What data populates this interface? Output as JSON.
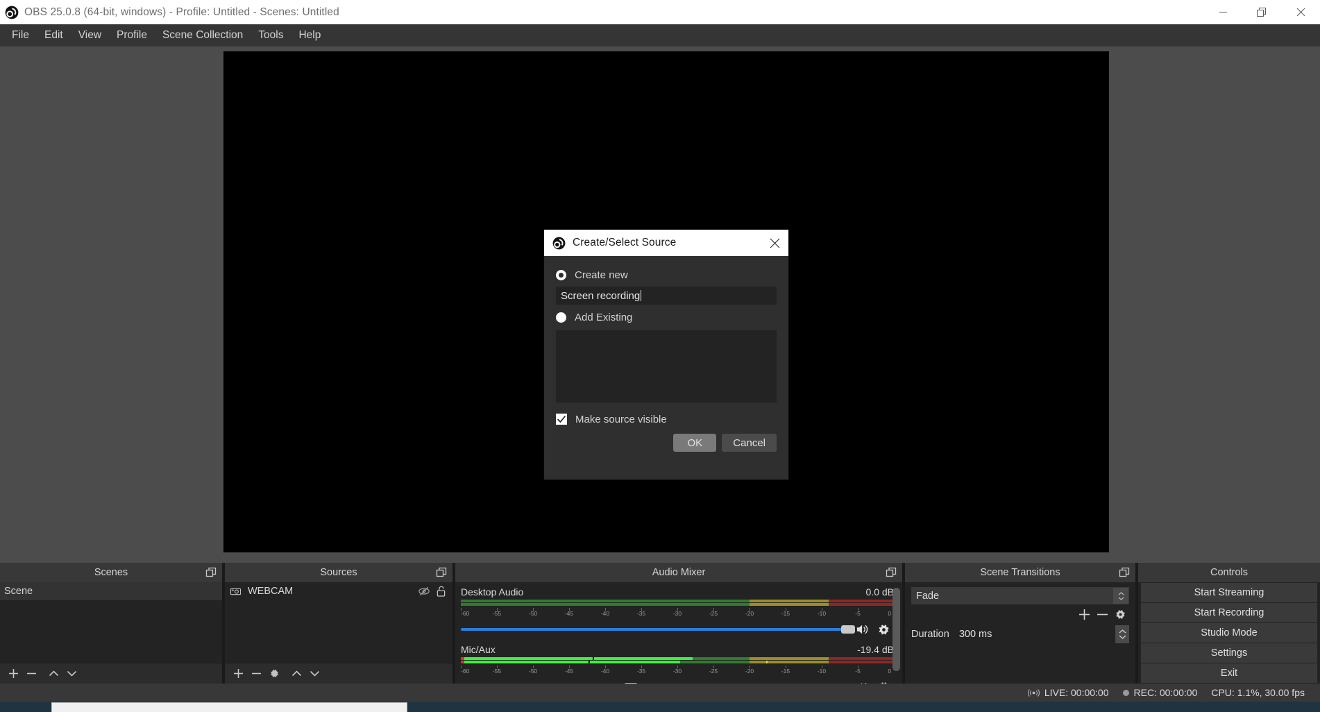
{
  "window": {
    "title": "OBS 25.0.8 (64-bit, windows) - Profile: Untitled - Scenes: Untitled",
    "logo_icon": "obs-logo-icon",
    "minimize_icon": "minimize-icon",
    "restore_icon": "restore-icon",
    "close_icon": "close-icon"
  },
  "menubar": {
    "items": [
      {
        "label": "File"
      },
      {
        "label": "Edit"
      },
      {
        "label": "View"
      },
      {
        "label": "Profile"
      },
      {
        "label": "Scene Collection"
      },
      {
        "label": "Tools"
      },
      {
        "label": "Help"
      }
    ]
  },
  "dialog": {
    "title": "Create/Select Source",
    "logo_icon": "obs-logo-icon",
    "close_icon": "close-icon",
    "create_new": {
      "label": "Create new",
      "selected": true
    },
    "source_name": {
      "value": "Screen recording",
      "placeholder": ""
    },
    "add_existing": {
      "label": "Add Existing",
      "selected": false
    },
    "existing_sources": [],
    "make_source_visible": {
      "label": "Make source visible",
      "checked": true
    },
    "ok_label": "OK",
    "cancel_label": "Cancel"
  },
  "docks": {
    "scenes": {
      "title": "Scenes",
      "popout_icon": "popout-icon",
      "items": [
        {
          "label": "Scene",
          "selected": true
        }
      ],
      "toolbar": [
        {
          "name": "add-scene-button",
          "icon": "plus-icon"
        },
        {
          "name": "remove-scene-button",
          "icon": "minus-icon"
        },
        {
          "name": "move-scene-up-button",
          "icon": "chevron-up-icon"
        },
        {
          "name": "move-scene-down-button",
          "icon": "chevron-down-icon"
        }
      ]
    },
    "sources": {
      "title": "Sources",
      "popout_icon": "popout-icon",
      "items": [
        {
          "label": "WEBCAM",
          "type_icon": "camera-icon",
          "visibility_icon": "eye-slash-icon",
          "lock_icon": "unlock-icon"
        }
      ],
      "toolbar": [
        {
          "name": "add-source-button",
          "icon": "plus-icon"
        },
        {
          "name": "remove-source-button",
          "icon": "minus-icon"
        },
        {
          "name": "source-properties-button",
          "icon": "gear-icon"
        },
        {
          "name": "move-source-up-button",
          "icon": "chevron-up-icon"
        },
        {
          "name": "move-source-down-button",
          "icon": "chevron-down-icon"
        }
      ]
    },
    "audio_mixer": {
      "title": "Audio Mixer",
      "popout_icon": "popout-icon",
      "scale_ticks": [
        "-60",
        "-55",
        "-50",
        "-45",
        "-40",
        "-35",
        "-30",
        "-25",
        "-20",
        "-15",
        "-10",
        "-5",
        "0"
      ],
      "tracks": [
        {
          "name": "Desktop Audio",
          "db": "0.0 dB",
          "level_percent": 0,
          "volume_percent": 100,
          "mute_icon": "speaker-icon",
          "settings_icon": "gear-icon"
        },
        {
          "name": "Mic/Aux",
          "db": "-19.4 dB",
          "level_percent": 53,
          "level_percent_2": 44,
          "volume_percent": 43,
          "mute_icon": "speaker-icon",
          "settings_icon": "gear-icon"
        }
      ]
    },
    "scene_transitions": {
      "title": "Scene Transitions",
      "popout_icon": "popout-icon",
      "transition": "Fade",
      "duration_label": "Duration",
      "duration_value": "300 ms",
      "toolbar": [
        {
          "name": "add-transition-button",
          "icon": "plus-icon"
        },
        {
          "name": "remove-transition-button",
          "icon": "minus-icon"
        },
        {
          "name": "transition-properties-button",
          "icon": "gear-icon"
        }
      ]
    },
    "controls": {
      "title": "Controls",
      "buttons": [
        {
          "label": "Start Streaming",
          "name": "start-streaming-button"
        },
        {
          "label": "Start Recording",
          "name": "start-recording-button"
        },
        {
          "label": "Studio Mode",
          "name": "studio-mode-button"
        },
        {
          "label": "Settings",
          "name": "settings-button"
        },
        {
          "label": "Exit",
          "name": "exit-button"
        }
      ]
    }
  },
  "statusbar": {
    "live_icon": "broadcast-icon",
    "live": "LIVE: 00:00:00",
    "rec_icon": "record-dot-icon",
    "rec": "REC: 00:00:00",
    "cpu": "CPU: 1.1%, 30.00 fps"
  },
  "colors": {
    "accent_blue": "#2b7fd4",
    "meter_green": "#3ef03e",
    "meter_green_dark": "#2d7d2d",
    "meter_yellow": "#9a8f28",
    "meter_red": "#8f2626",
    "clip_red": "#ec2b2b"
  }
}
